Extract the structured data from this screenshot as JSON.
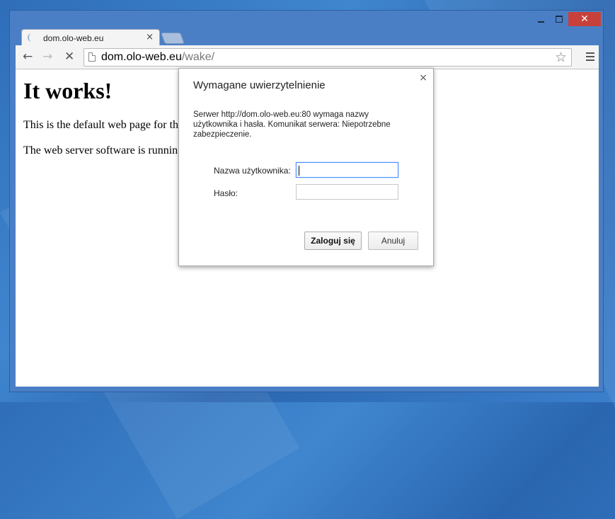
{
  "window": {
    "controls": {
      "minimize": "minimize",
      "maximize": "maximize",
      "close": "✕"
    }
  },
  "tab": {
    "title": "dom.olo-web.eu",
    "close": "×"
  },
  "toolbar": {
    "back": "←",
    "forward": "→",
    "stop": "✕",
    "url_host": "dom.olo-web.eu",
    "url_path": "/wake/",
    "star": "☆"
  },
  "page": {
    "heading": "It works!",
    "line1": "This is the default web page for this s",
    "line2": "The web server software is running b"
  },
  "dialog": {
    "title": "Wymagane uwierzytelnienie",
    "close": "×",
    "message": "Serwer http://dom.olo-web.eu:80 wymaga nazwy użytkownika i hasła. Komunikat serwera: Niepotrzebne zabezpieczenie.",
    "username_label": "Nazwa użytkownika:",
    "password_label": "Hasło:",
    "username_value": "",
    "password_value": "",
    "login_button": "Zaloguj się",
    "cancel_button": "Anuluj"
  },
  "colors": {
    "desktop": "#3a7cc6",
    "window_frame": "#4a7fc6",
    "close_button": "#c7413a",
    "focus_border": "#4d90fe"
  }
}
